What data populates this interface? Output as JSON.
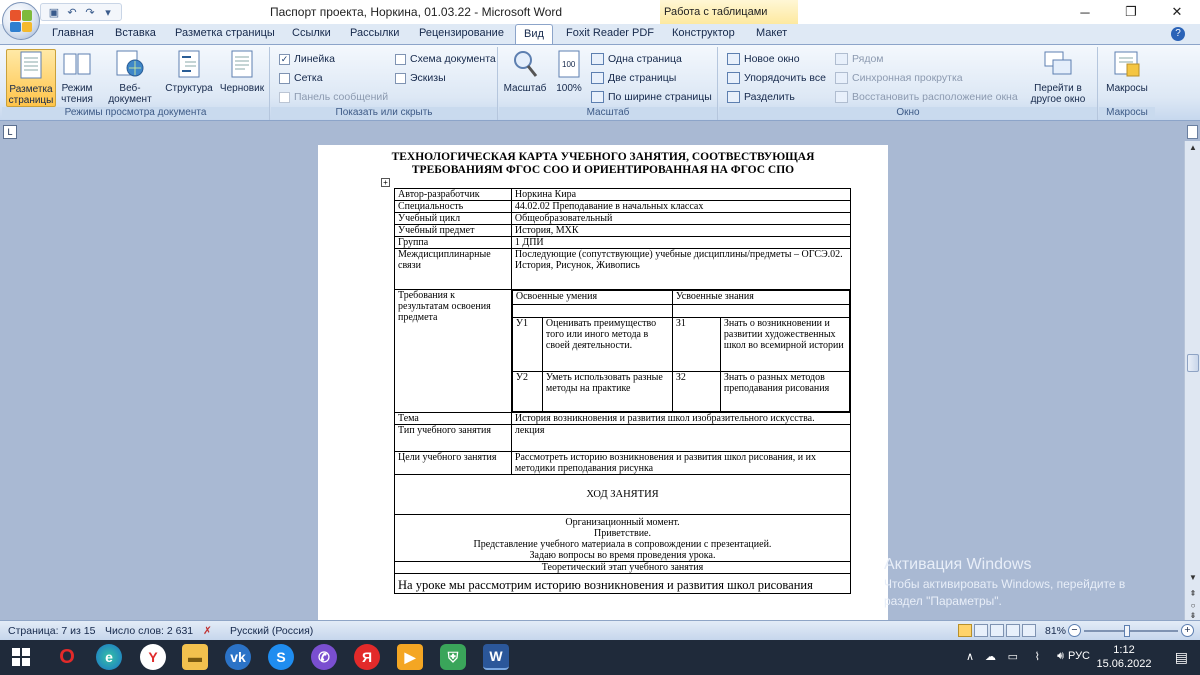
{
  "window": {
    "title": "Паспорт проекта, Норкина, 01.03.22 - Microsoft Word",
    "context_tab_title": "Работа с таблицами",
    "controls": {
      "minimize": "─",
      "restore": "❐",
      "close": "✕"
    }
  },
  "tabs": [
    "Главная",
    "Вставка",
    "Разметка страницы",
    "Ссылки",
    "Рассылки",
    "Рецензирование",
    "Вид",
    "Foxit Reader PDF",
    "Конструктор",
    "Макет"
  ],
  "active_tab": "Вид",
  "ribbon": {
    "views_group": {
      "label": "Режимы просмотра документа",
      "buttons": [
        "Разметка страницы",
        "Режим чтения",
        "Веб-документ",
        "Структура",
        "Черновик"
      ]
    },
    "show_group": {
      "label": "Показать или скрыть",
      "items": [
        {
          "label": "Линейка",
          "checked": true
        },
        {
          "label": "Сетка",
          "checked": false
        },
        {
          "label": "Панель сообщений",
          "checked": false,
          "disabled": true
        },
        {
          "label": "Схема документа",
          "checked": false
        },
        {
          "label": "Эскизы",
          "checked": false
        }
      ]
    },
    "zoom_group": {
      "label": "Масштаб",
      "zoom_label": "Масштаб",
      "hundred_label": "100%",
      "one_page": "Одна страница",
      "two_pages": "Две страницы",
      "page_width": "По ширине страницы"
    },
    "window_group": {
      "label": "Окно",
      "new_window": "Новое окно",
      "arrange_all": "Упорядочить все",
      "split": "Разделить",
      "side_by_side": "Рядом",
      "sync_scroll": "Синхронная прокрутка",
      "reset_position": "Восстановить расположение окна",
      "switch_window": "Перейти в другое окно"
    },
    "macros_group": {
      "label": "Макросы",
      "button": "Макросы"
    }
  },
  "document": {
    "heading": "ТЕХНОЛОГИЧЕСКАЯ КАРТА УЧЕБНОГО ЗАНЯТИЯ, СООТВЕСТВУЮЩАЯ ТРЕБОВАНИЯМ ФГОС СОО И ОРИЕНТИРОВАННАЯ НА ФГОС СПО",
    "rows": [
      {
        "label": "Автор-разработчик",
        "value": "Норкина Кира"
      },
      {
        "label": "Специальность",
        "value": "44.02.02 Преподавание в начальных классах"
      },
      {
        "label": "Учебный цикл",
        "value": "Общеобразовательный"
      },
      {
        "label": "Учебный предмет",
        "value": "История, МХК"
      },
      {
        "label": "Группа",
        "value": "1 ДПИ"
      },
      {
        "label": "Междисциплинарные связи",
        "value": "Последующие (сопутствующие) учебные дисциплины/предметы – ОГСЭ.02. История, Рисунок, Живопись"
      }
    ],
    "requirements": {
      "label": "Требования к результатам освоения предмета",
      "skills_header": "Освоенные умения",
      "knowledge_header": "Усвоенные знания",
      "rows": [
        {
          "skill_code": "У1",
          "skill": "Оценивать преимущество того или иного метода в своей деятельности.",
          "know_code": "З1",
          "knowledge": "Знать о возникновении и развитии художественных школ во всемирной истории"
        },
        {
          "skill_code": "У2",
          "skill": "Уметь использовать разные методы на практике",
          "know_code": "З2",
          "knowledge": "Знать о разных методов преподавания рисования"
        }
      ]
    },
    "rows2": [
      {
        "label": "Тема",
        "value": "История возникновения и развития школ изобразительного искусства."
      },
      {
        "label": "Тип учебного занятия",
        "value": "лекция"
      },
      {
        "label": "Цели учебного занятия",
        "value": "Рассмотреть историю возникновения и развития школ рисования, и их методики преподавания рисунка"
      }
    ],
    "progress_title": "ХОД ЗАНЯТИЯ",
    "org_block": [
      "Организационный момент.",
      "Приветствие.",
      "Представление учебного материала в сопровождении с презентацией.",
      "Задаю вопросы во время проведения урока."
    ],
    "theory_title": "Теоретический этап учебного занятия",
    "theory_text": "На уроке мы рассмотрим историю возникновения и развития школ рисования"
  },
  "watermark": {
    "title": "Активация Windows",
    "line1": "Чтобы активировать Windows, перейдите в",
    "line2": "раздел \"Параметры\"."
  },
  "status": {
    "page": "Страница: 7 из 15",
    "words": "Число слов: 2 631",
    "language": "Русский (Россия)",
    "zoom": "81%"
  },
  "taskbar": {
    "lang": "РУС",
    "time": "1:12",
    "date": "15.06.2022"
  },
  "colors": {
    "accent": "#2b579a",
    "ribbon_bg": "#dde8f5",
    "active_button": "#ffc44a",
    "doc_bg": "#a9b9d3",
    "taskbar": "#1f2a3a"
  }
}
